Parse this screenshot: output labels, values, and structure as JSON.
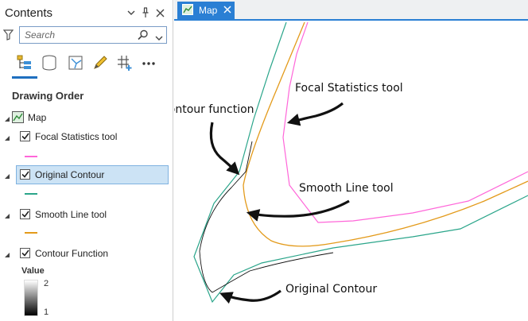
{
  "contents": {
    "title": "Contents",
    "search_placeholder": "Search",
    "drawing_order_title": "Drawing Order",
    "map_label": "Map",
    "layers": [
      {
        "label": "Focal Statistics tool",
        "checked": true,
        "symbol_color": "#ff66d9"
      },
      {
        "label": "Original Contour",
        "checked": true,
        "symbol_color": "#2aa58a",
        "selected": true
      },
      {
        "label": "Smooth Line tool",
        "checked": true,
        "symbol_color": "#e39a1a"
      },
      {
        "label": "Contour Function",
        "checked": true
      }
    ],
    "legend": {
      "title": "Value",
      "high": "2",
      "low": "1"
    }
  },
  "map_tab": {
    "label": "Map"
  },
  "annotations": {
    "focal": "Focal Statistics tool",
    "contour_function": "Contour function",
    "smooth": "Smooth Line tool",
    "original": "Original Contour"
  },
  "line_colors": {
    "focal": "#ff66d9",
    "smooth": "#e39a1a",
    "original": "#2aa58a",
    "contour_function": "#111111",
    "accent": "#2a7fd4"
  },
  "icons": [
    "filter-icon",
    "search-icon",
    "chevron-down-icon",
    "pin-icon",
    "close-icon",
    "list-by-drawing-order-icon",
    "list-by-source-icon",
    "list-by-selection-icon",
    "list-by-editing-icon",
    "list-by-snapping-icon",
    "more-icon",
    "map-icon"
  ]
}
